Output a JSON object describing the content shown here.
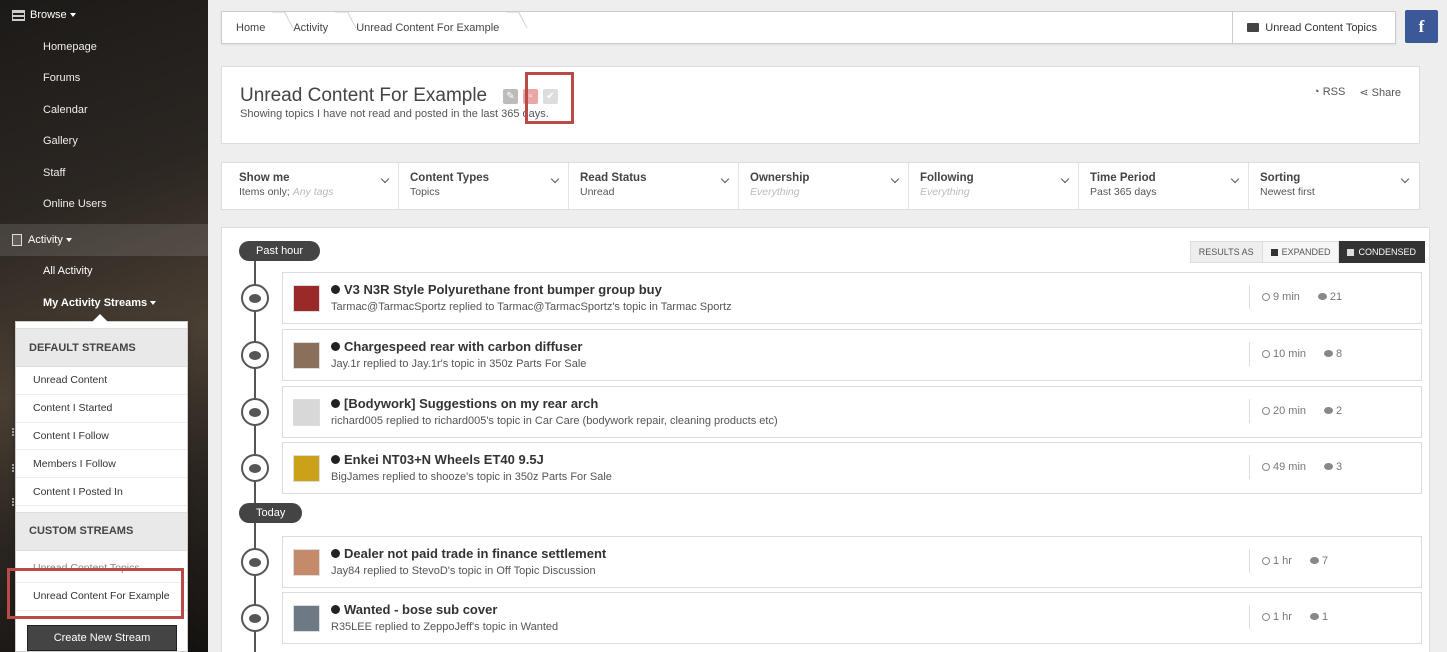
{
  "sidebar": {
    "browse_label": "Browse",
    "browse_items": [
      "Homepage",
      "Forums",
      "Calendar",
      "Gallery",
      "Staff",
      "Online Users"
    ],
    "activity_label": "Activity",
    "all_activity": "All Activity",
    "my_streams": "My Activity Streams"
  },
  "dropdown": {
    "default_header": "DEFAULT STREAMS",
    "default_items": [
      "Unread Content",
      "Content I Started",
      "Content I Follow",
      "Members I Follow",
      "Content I Posted In"
    ],
    "custom_header": "CUSTOM STREAMS",
    "custom_items": [
      "Unread Content Topics",
      "Unread Content For Example"
    ],
    "create_button": "Create New Stream"
  },
  "breadcrumb": {
    "items": [
      "Home",
      "Activity",
      "Unread Content For Example"
    ],
    "right_button": "Unread Content Topics",
    "facebook": "f"
  },
  "header": {
    "title": "Unread Content For Example",
    "subtitle": "Showing topics I have not read and posted in the last 365 days.",
    "rss": "RSS",
    "share": "Share"
  },
  "filters": [
    {
      "label": "Show me",
      "value": "Items only;",
      "extra": "Any tags"
    },
    {
      "label": "Content Types",
      "value": "Topics",
      "extra": ""
    },
    {
      "label": "Read Status",
      "value": "Unread",
      "extra": ""
    },
    {
      "label": "Ownership",
      "value": "",
      "extra": "Everything"
    },
    {
      "label": "Following",
      "value": "",
      "extra": "Everything"
    },
    {
      "label": "Time Period",
      "value": "Past 365 days",
      "extra": ""
    },
    {
      "label": "Sorting",
      "value": "Newest first",
      "extra": ""
    }
  ],
  "results_as": {
    "label": "RESULTS AS",
    "expanded": "EXPANDED",
    "condensed": "CONDENSED"
  },
  "groups": {
    "past_hour": "Past hour",
    "today": "Today"
  },
  "items": [
    {
      "title": "V3 N3R Style Polyurethane front bumper group buy",
      "sub": "Tarmac@TarmacSportz replied to Tarmac@TarmacSportz's topic in Tarmac Sportz",
      "time": "9 min",
      "replies": "21",
      "avatar": "#9a2a2a"
    },
    {
      "title": "Chargespeed rear with carbon diffuser",
      "sub": "Jay.1r replied to Jay.1r's topic in 350z Parts For Sale",
      "time": "10 min",
      "replies": "8",
      "avatar": "#8a6f5a"
    },
    {
      "title": "[Bodywork] Suggestions on my rear arch",
      "sub": "richard005 replied to richard005's topic in Car Care (bodywork repair, cleaning products etc)",
      "time": "20 min",
      "replies": "2",
      "avatar": "#d8d8d8"
    },
    {
      "title": "Enkei NT03+N Wheels ET40 9.5J",
      "sub": "BigJames replied to shooze's topic in 350z Parts For Sale",
      "time": "49 min",
      "replies": "3",
      "avatar": "#c9a21a"
    },
    {
      "title": "Dealer not paid trade in finance settlement",
      "sub": "Jay84 replied to StevoD's topic in Off Topic Discussion",
      "time": "1 hr",
      "replies": "7",
      "avatar": "#c58a6a"
    },
    {
      "title": "Wanted - bose sub cover",
      "sub": "R35LEE replied to ZeppoJeff's topic in Wanted",
      "time": "1 hr",
      "replies": "1",
      "avatar": "#6d7a86"
    }
  ]
}
